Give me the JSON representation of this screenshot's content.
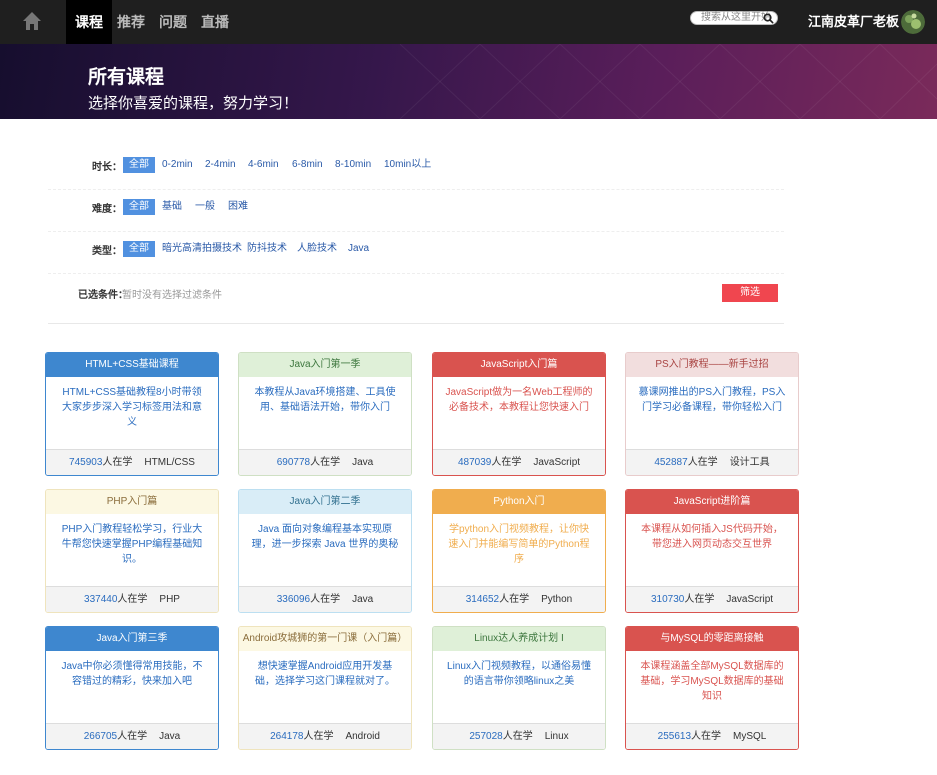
{
  "nav": {
    "items": [
      "课程",
      "推荐",
      "问题",
      "直播"
    ],
    "search_placeholder": "搜索从这里开始",
    "username": "江南皮革厂老板"
  },
  "banner": {
    "title": "所有课程",
    "subtitle": "选择你喜爱的课程，努力学习！"
  },
  "filters": {
    "duration": {
      "label": "时长：",
      "options": [
        "全部",
        "0-2min",
        "2-4min",
        "4-6min",
        "6-8min",
        "8-10min",
        "10min以上"
      ],
      "selected": "全部"
    },
    "difficulty": {
      "label": "难度：",
      "options": [
        "全部",
        "基础",
        "一般",
        "困难"
      ],
      "selected": "全部"
    },
    "type": {
      "label": "类型：",
      "options": [
        "全部",
        "暗光高清拍摄技术",
        "防抖技术",
        "人脸技术",
        "Java"
      ],
      "selected": "全部"
    },
    "selected_label": "已选条件：",
    "selected_value": "暂时没有选择过滤条件",
    "button": "筛选"
  },
  "courses": [
    {
      "title": "HTML+CSS基础课程",
      "desc": "HTML+CSS基础教程8小时带领大家步步深入学习标签用法和意义",
      "count": "745903",
      "unit": "人在学",
      "tag": "HTML/CSS",
      "theme": "blue"
    },
    {
      "title": "Java入门第一季",
      "desc": "本教程从Java环境搭建、工具使用、基础语法开始，带你入门",
      "count": "690778",
      "unit": "人在学",
      "tag": "Java",
      "theme": "green"
    },
    {
      "title": "JavaScript入门篇",
      "desc": "JavaScript做为一名Web工程师的必备技术，本教程让您快速入门",
      "count": "487039",
      "unit": "人在学",
      "tag": "JavaScript",
      "theme": "red"
    },
    {
      "title": "PS入门教程——新手过招",
      "desc": "慕课网推出的PS入门教程，PS入门学习必备课程，带你轻松入门",
      "count": "452887",
      "unit": "人在学",
      "tag": "设计工具",
      "theme": "pink"
    },
    {
      "title": "PHP入门篇",
      "desc": "PHP入门教程轻松学习，行业大牛帮您快速掌握PHP编程基础知识。",
      "count": "337440",
      "unit": "人在学",
      "tag": "PHP",
      "theme": "yellow"
    },
    {
      "title": "Java入门第二季",
      "desc": "Java 面向对象编程基本实现原理，进一步探索 Java 世界的奥秘",
      "count": "336096",
      "unit": "人在学",
      "tag": "Java",
      "theme": "lightblue"
    },
    {
      "title": "Python入门",
      "desc": "学python入门视频教程，让你快速入门并能编写简单的Python程序",
      "count": "314652",
      "unit": "人在学",
      "tag": "Python",
      "theme": "orange"
    },
    {
      "title": "JavaScript进阶篇",
      "desc": "本课程从如何插入JS代码开始，带您进入网页动态交互世界",
      "count": "310730",
      "unit": "人在学",
      "tag": "JavaScript",
      "theme": "red"
    },
    {
      "title": "Java入门第三季",
      "desc": "Java中你必须懂得常用技能，不容错过的精彩，快来加入吧",
      "count": "266705",
      "unit": "人在学",
      "tag": "Java",
      "theme": "blue"
    },
    {
      "title": "Android攻城狮的第一门课（入门篇）",
      "desc": "想快速掌握Android应用开发基础，选择学习这门课程就对了。",
      "count": "264178",
      "unit": "人在学",
      "tag": "Android",
      "theme": "yellow"
    },
    {
      "title": "Linux达人养成计划 I",
      "desc": "Linux入门视频教程，以通俗易懂的语言带你领略linux之美",
      "count": "257028",
      "unit": "人在学",
      "tag": "Linux",
      "theme": "green"
    },
    {
      "title": "与MySQL的零距离接触",
      "desc": "本课程涵盖全部MySQL数据库的基础，学习MySQL数据库的基础知识",
      "count": "255613",
      "unit": "人在学",
      "tag": "MySQL",
      "theme": "red"
    }
  ],
  "themes": {
    "blue": {
      "head_bg": "#3e87cf",
      "head_fg": "#ffffff",
      "desc_fg": "#2a6cbf",
      "border": "#3e87cf"
    },
    "green": {
      "head_bg": "#dff0d8",
      "head_fg": "#3c763d",
      "desc_fg": "#2a6cbf",
      "border": "#cfe0c4"
    },
    "red": {
      "head_bg": "#d9534f",
      "head_fg": "#ffffff",
      "desc_fg": "#d9534f",
      "border": "#d9534f"
    },
    "pink": {
      "head_bg": "#f2dede",
      "head_fg": "#a94442",
      "desc_fg": "#2a6cbf",
      "border": "#e8cccc"
    },
    "yellow": {
      "head_bg": "#fcf8e3",
      "head_fg": "#8a6d3b",
      "desc_fg": "#2a6cbf",
      "border": "#efe4bd"
    },
    "lightblue": {
      "head_bg": "#d9edf7",
      "head_fg": "#31708f",
      "desc_fg": "#2a6cbf",
      "border": "#bcdff1"
    },
    "orange": {
      "head_bg": "#f0ad4e",
      "head_fg": "#ffffff",
      "desc_fg": "#f0ad4e",
      "border": "#f0ad4e"
    }
  }
}
